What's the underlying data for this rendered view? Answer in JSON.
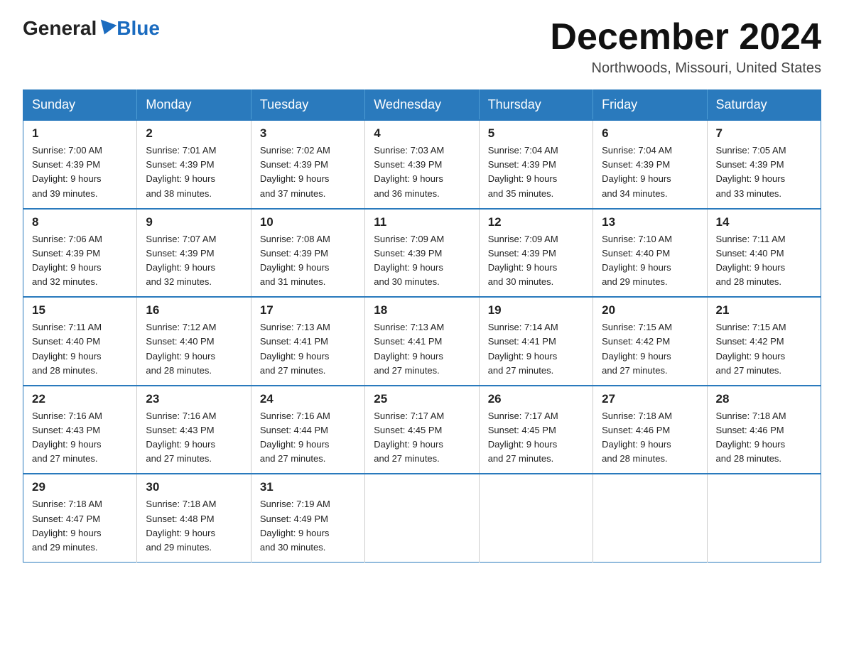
{
  "header": {
    "logo_general": "General",
    "logo_blue": "Blue",
    "month_title": "December 2024",
    "location": "Northwoods, Missouri, United States"
  },
  "days_of_week": [
    "Sunday",
    "Monday",
    "Tuesday",
    "Wednesday",
    "Thursday",
    "Friday",
    "Saturday"
  ],
  "weeks": [
    [
      {
        "day": "1",
        "sunrise": "7:00 AM",
        "sunset": "4:39 PM",
        "daylight": "9 hours and 39 minutes."
      },
      {
        "day": "2",
        "sunrise": "7:01 AM",
        "sunset": "4:39 PM",
        "daylight": "9 hours and 38 minutes."
      },
      {
        "day": "3",
        "sunrise": "7:02 AM",
        "sunset": "4:39 PM",
        "daylight": "9 hours and 37 minutes."
      },
      {
        "day": "4",
        "sunrise": "7:03 AM",
        "sunset": "4:39 PM",
        "daylight": "9 hours and 36 minutes."
      },
      {
        "day": "5",
        "sunrise": "7:04 AM",
        "sunset": "4:39 PM",
        "daylight": "9 hours and 35 minutes."
      },
      {
        "day": "6",
        "sunrise": "7:04 AM",
        "sunset": "4:39 PM",
        "daylight": "9 hours and 34 minutes."
      },
      {
        "day": "7",
        "sunrise": "7:05 AM",
        "sunset": "4:39 PM",
        "daylight": "9 hours and 33 minutes."
      }
    ],
    [
      {
        "day": "8",
        "sunrise": "7:06 AM",
        "sunset": "4:39 PM",
        "daylight": "9 hours and 32 minutes."
      },
      {
        "day": "9",
        "sunrise": "7:07 AM",
        "sunset": "4:39 PM",
        "daylight": "9 hours and 32 minutes."
      },
      {
        "day": "10",
        "sunrise": "7:08 AM",
        "sunset": "4:39 PM",
        "daylight": "9 hours and 31 minutes."
      },
      {
        "day": "11",
        "sunrise": "7:09 AM",
        "sunset": "4:39 PM",
        "daylight": "9 hours and 30 minutes."
      },
      {
        "day": "12",
        "sunrise": "7:09 AM",
        "sunset": "4:39 PM",
        "daylight": "9 hours and 30 minutes."
      },
      {
        "day": "13",
        "sunrise": "7:10 AM",
        "sunset": "4:40 PM",
        "daylight": "9 hours and 29 minutes."
      },
      {
        "day": "14",
        "sunrise": "7:11 AM",
        "sunset": "4:40 PM",
        "daylight": "9 hours and 28 minutes."
      }
    ],
    [
      {
        "day": "15",
        "sunrise": "7:11 AM",
        "sunset": "4:40 PM",
        "daylight": "9 hours and 28 minutes."
      },
      {
        "day": "16",
        "sunrise": "7:12 AM",
        "sunset": "4:40 PM",
        "daylight": "9 hours and 28 minutes."
      },
      {
        "day": "17",
        "sunrise": "7:13 AM",
        "sunset": "4:41 PM",
        "daylight": "9 hours and 27 minutes."
      },
      {
        "day": "18",
        "sunrise": "7:13 AM",
        "sunset": "4:41 PM",
        "daylight": "9 hours and 27 minutes."
      },
      {
        "day": "19",
        "sunrise": "7:14 AM",
        "sunset": "4:41 PM",
        "daylight": "9 hours and 27 minutes."
      },
      {
        "day": "20",
        "sunrise": "7:15 AM",
        "sunset": "4:42 PM",
        "daylight": "9 hours and 27 minutes."
      },
      {
        "day": "21",
        "sunrise": "7:15 AM",
        "sunset": "4:42 PM",
        "daylight": "9 hours and 27 minutes."
      }
    ],
    [
      {
        "day": "22",
        "sunrise": "7:16 AM",
        "sunset": "4:43 PM",
        "daylight": "9 hours and 27 minutes."
      },
      {
        "day": "23",
        "sunrise": "7:16 AM",
        "sunset": "4:43 PM",
        "daylight": "9 hours and 27 minutes."
      },
      {
        "day": "24",
        "sunrise": "7:16 AM",
        "sunset": "4:44 PM",
        "daylight": "9 hours and 27 minutes."
      },
      {
        "day": "25",
        "sunrise": "7:17 AM",
        "sunset": "4:45 PM",
        "daylight": "9 hours and 27 minutes."
      },
      {
        "day": "26",
        "sunrise": "7:17 AM",
        "sunset": "4:45 PM",
        "daylight": "9 hours and 27 minutes."
      },
      {
        "day": "27",
        "sunrise": "7:18 AM",
        "sunset": "4:46 PM",
        "daylight": "9 hours and 28 minutes."
      },
      {
        "day": "28",
        "sunrise": "7:18 AM",
        "sunset": "4:46 PM",
        "daylight": "9 hours and 28 minutes."
      }
    ],
    [
      {
        "day": "29",
        "sunrise": "7:18 AM",
        "sunset": "4:47 PM",
        "daylight": "9 hours and 29 minutes."
      },
      {
        "day": "30",
        "sunrise": "7:18 AM",
        "sunset": "4:48 PM",
        "daylight": "9 hours and 29 minutes."
      },
      {
        "day": "31",
        "sunrise": "7:19 AM",
        "sunset": "4:49 PM",
        "daylight": "9 hours and 30 minutes."
      },
      null,
      null,
      null,
      null
    ]
  ],
  "labels": {
    "sunrise": "Sunrise: ",
    "sunset": "Sunset: ",
    "daylight": "Daylight: "
  }
}
